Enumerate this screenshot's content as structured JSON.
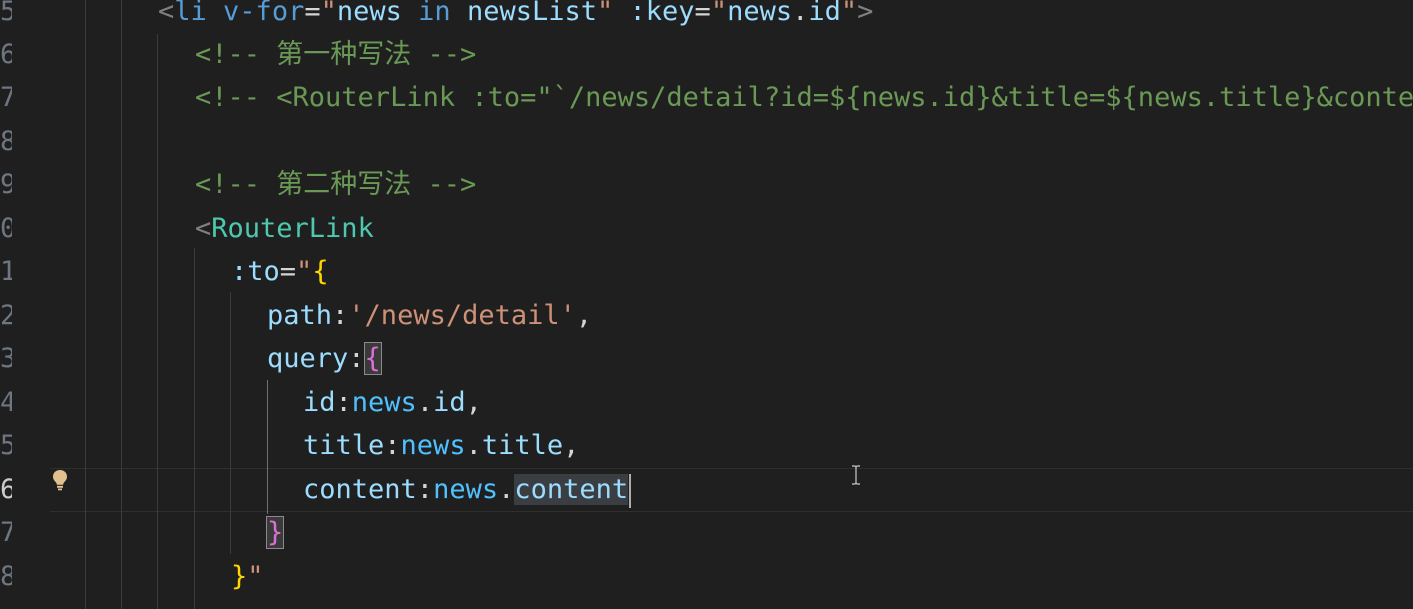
{
  "editor": {
    "line_numbers": [
      "5",
      "6",
      "7",
      "8",
      "9",
      "0",
      "1",
      "2",
      "3",
      "4",
      "5",
      "6",
      "7",
      "8"
    ],
    "active_line_index": 11,
    "lines": [
      {
        "tokens": [
          {
            "c": "t-punc",
            "t": "<"
          },
          {
            "c": "t-tag",
            "t": "li"
          },
          {
            "c": "t-txt",
            "t": " "
          },
          {
            "c": "t-blue",
            "t": "v-for"
          },
          {
            "c": "t-txt",
            "t": "="
          },
          {
            "c": "t-str",
            "t": "\""
          },
          {
            "c": "t-attr",
            "t": "news"
          },
          {
            "c": "t-txt",
            "t": " "
          },
          {
            "c": "t-blue",
            "t": "in"
          },
          {
            "c": "t-txt",
            "t": " "
          },
          {
            "c": "t-attr",
            "t": "newsList"
          },
          {
            "c": "t-str",
            "t": "\""
          },
          {
            "c": "t-txt",
            "t": " "
          },
          {
            "c": "t-attr",
            "t": ":key"
          },
          {
            "c": "t-txt",
            "t": "="
          },
          {
            "c": "t-str",
            "t": "\""
          },
          {
            "c": "t-attr",
            "t": "news"
          },
          {
            "c": "t-txt",
            "t": "."
          },
          {
            "c": "t-attr",
            "t": "id"
          },
          {
            "c": "t-str",
            "t": "\""
          },
          {
            "c": "t-punc",
            "t": ">"
          }
        ]
      },
      {
        "tokens": [
          {
            "c": "t-com",
            "t": "<!-- 第一种写法 -->"
          }
        ]
      },
      {
        "tokens": [
          {
            "c": "t-com",
            "t": "<!-- <RouterLink :to=\"`/news/detail?id=${news.id}&title=${news.title}&content=${news.content}`\">{{news.title}}</RouterLink> -->"
          }
        ]
      },
      {
        "tokens": []
      },
      {
        "tokens": [
          {
            "c": "t-com",
            "t": "<!-- 第二种写法 -->"
          }
        ]
      },
      {
        "tokens": [
          {
            "c": "t-punc",
            "t": "<"
          },
          {
            "c": "t-comp",
            "t": "RouterLink"
          }
        ]
      },
      {
        "tokens": [
          {
            "c": "t-attr",
            "t": ":to"
          },
          {
            "c": "t-txt",
            "t": "="
          },
          {
            "c": "t-str",
            "t": "\""
          },
          {
            "c": "t-b1",
            "t": "{"
          }
        ]
      },
      {
        "tokens": [
          {
            "c": "t-attr",
            "t": "path"
          },
          {
            "c": "t-txt",
            "t": ":"
          },
          {
            "c": "t-str",
            "t": "'/news/detail'"
          },
          {
            "c": "t-txt",
            "t": ","
          }
        ]
      },
      {
        "tokens": [
          {
            "c": "t-attr",
            "t": "query"
          },
          {
            "c": "t-txt",
            "t": ":"
          },
          {
            "c": "t-b2 bracket-match",
            "t": "{"
          }
        ]
      },
      {
        "tokens": [
          {
            "c": "t-attr",
            "t": "id"
          },
          {
            "c": "t-txt",
            "t": ":"
          },
          {
            "c": "t-var",
            "t": "news"
          },
          {
            "c": "t-txt",
            "t": "."
          },
          {
            "c": "t-attr",
            "t": "id"
          },
          {
            "c": "t-txt",
            "t": ","
          }
        ]
      },
      {
        "tokens": [
          {
            "c": "t-attr",
            "t": "title"
          },
          {
            "c": "t-txt",
            "t": ":"
          },
          {
            "c": "t-var",
            "t": "news"
          },
          {
            "c": "t-txt",
            "t": "."
          },
          {
            "c": "t-attr",
            "t": "title"
          },
          {
            "c": "t-txt",
            "t": ","
          }
        ]
      },
      {
        "tokens": [
          {
            "c": "t-attr",
            "t": "content"
          },
          {
            "c": "t-txt",
            "t": ":"
          },
          {
            "c": "t-var",
            "t": "news"
          },
          {
            "c": "t-txt",
            "t": "."
          },
          {
            "c": "t-attr sel",
            "t": "content"
          }
        ],
        "caret": true
      },
      {
        "tokens": [
          {
            "c": "t-b2 bracket-match",
            "t": "}"
          }
        ]
      },
      {
        "tokens": [
          {
            "c": "t-b1",
            "t": "}"
          },
          {
            "c": "t-str",
            "t": "\""
          }
        ]
      }
    ]
  },
  "icons": {
    "lightbulb": "lightbulb-icon",
    "cursor": "text-cursor-icon"
  },
  "colors": {
    "background": "#1f1f1f",
    "comment": "#6a9955",
    "string": "#ce9178",
    "attribute": "#9cdcfe",
    "component": "#4ec9b0"
  }
}
